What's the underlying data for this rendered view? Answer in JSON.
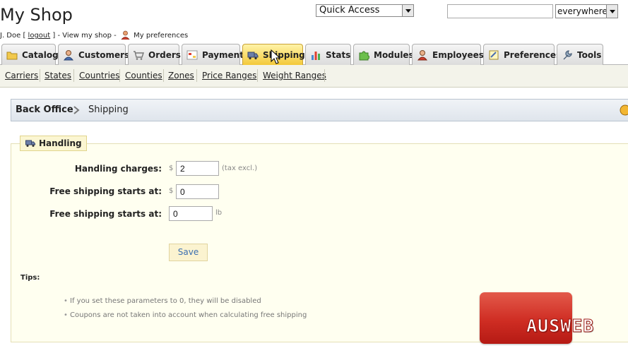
{
  "header": {
    "shop_name": "My Shop",
    "user_name": "J. Doe [",
    "logout_label": "logout",
    "sep_1": "] - View my shop -",
    "preferences_label": "My preferences"
  },
  "quick_access": {
    "selected": "Quick Access"
  },
  "search": {
    "value": "",
    "scope": "everywhere"
  },
  "tabs": [
    {
      "label": "Catalog",
      "icon": "folder-icon"
    },
    {
      "label": "Customers",
      "icon": "user-icon"
    },
    {
      "label": "Orders",
      "icon": "cart-icon"
    },
    {
      "label": "Payment",
      "icon": "payment-icon"
    },
    {
      "label": "Shipping",
      "icon": "truck-icon",
      "active": true
    },
    {
      "label": "Stats",
      "icon": "bar-chart-icon"
    },
    {
      "label": "Modules",
      "icon": "puzzle-icon"
    },
    {
      "label": "Employees",
      "icon": "employee-icon"
    },
    {
      "label": "Preferences",
      "icon": "preferences-icon"
    },
    {
      "label": "Tools",
      "icon": "wrench-icon"
    }
  ],
  "subnav": [
    "Carriers",
    "States",
    "Countries",
    "Counties",
    "Zones",
    "Price Ranges",
    "Weight Ranges"
  ],
  "breadcrumb": {
    "home": "Back Office",
    "current": "Shipping"
  },
  "handling": {
    "legend": "Handling",
    "fields": [
      {
        "label": "Handling charges:",
        "currency": "$",
        "value": "2",
        "unit": "(tax excl.)"
      },
      {
        "label": "Free shipping starts at:",
        "currency": "$",
        "value": "0",
        "unit": ""
      },
      {
        "label": "Free shipping starts at:",
        "currency": "",
        "value": "0",
        "unit": "lb"
      }
    ],
    "save_label": "Save"
  },
  "tips": {
    "title": "Tips:",
    "items": [
      "If you set these parameters to 0, they will be disabled",
      "Coupons are not taken into account when calculating free shipping"
    ]
  },
  "watermark": {
    "text": "AUSWEB"
  },
  "colors": {
    "active_tab": "#f3c93a",
    "panel_bg": "#fffff0",
    "save_text": "#3c6fb0",
    "watermark": "#cf2d23"
  }
}
